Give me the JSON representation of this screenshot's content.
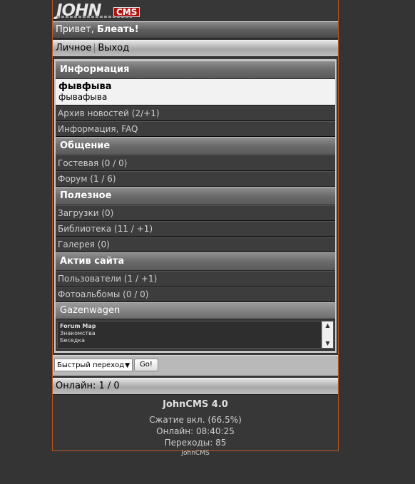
{
  "logo": {
    "word": "JOHN",
    "badge": "CMS"
  },
  "greeting": {
    "prefix": "Привет,",
    "name": "Блеать!"
  },
  "nav": {
    "personal": "Личное",
    "logout": "Выход"
  },
  "sections": {
    "info": "Информация",
    "chat": "Общение",
    "useful": "Полезное",
    "activity": "Актив сайта"
  },
  "news": {
    "title": "фывфыва",
    "body": "фывафыва"
  },
  "items": {
    "news_archive": "Архив новостей (2/+1)",
    "faq": "Информация, FAQ",
    "guestbook": "Гостевая (0 / 0)",
    "forum": "Форум (1 / 6)",
    "downloads": "Загрузки (0)",
    "library": "Библиотека (11 / +1)",
    "gallery": "Галерея (0)",
    "users": "Пользователи (1 / +1)",
    "albums": "Фотоальбомы (0 / 0)"
  },
  "gazenwagen": {
    "title": "Gazenwagen",
    "lines": [
      "Forum Map",
      "Знакомства",
      "Беседка"
    ]
  },
  "jump": {
    "select": "Быстрый переход",
    "go": "Go!"
  },
  "online": "Онлайн: 1 / 0",
  "footer": {
    "title": "JohnCMS 4.0",
    "compress": "Сжатие вкл. (66.5%)",
    "online_time": "Онлайн: 08:40:25",
    "hits": "Переходы: 85",
    "copyright": "JohnCMS"
  }
}
